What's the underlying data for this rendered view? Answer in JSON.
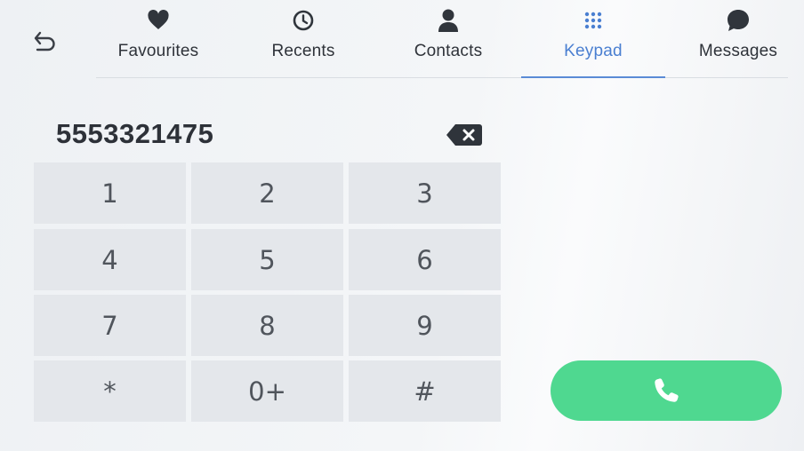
{
  "tabs": [
    {
      "label": "Favourites",
      "icon": "heart-icon",
      "active": false
    },
    {
      "label": "Recents",
      "icon": "clock-icon",
      "active": false
    },
    {
      "label": "Contacts",
      "icon": "person-icon",
      "active": false
    },
    {
      "label": "Keypad",
      "icon": "dialpad-icon",
      "active": true
    },
    {
      "label": "Messages",
      "icon": "chat-bubble-icon",
      "active": false
    }
  ],
  "back_icon": "undo-arrow-icon",
  "dialed_number": "5553321475",
  "backspace_icon": "backspace-icon",
  "keypad": {
    "keys": [
      "1",
      "2",
      "3",
      "4",
      "5",
      "6",
      "7",
      "8",
      "9",
      "*",
      "0+",
      "#"
    ]
  },
  "call_icon": "phone-icon",
  "colors": {
    "accent": "#4a7fd1",
    "call_button": "#4fd890",
    "key_background": "#e4e7eb",
    "text_dark": "#2d3138"
  }
}
